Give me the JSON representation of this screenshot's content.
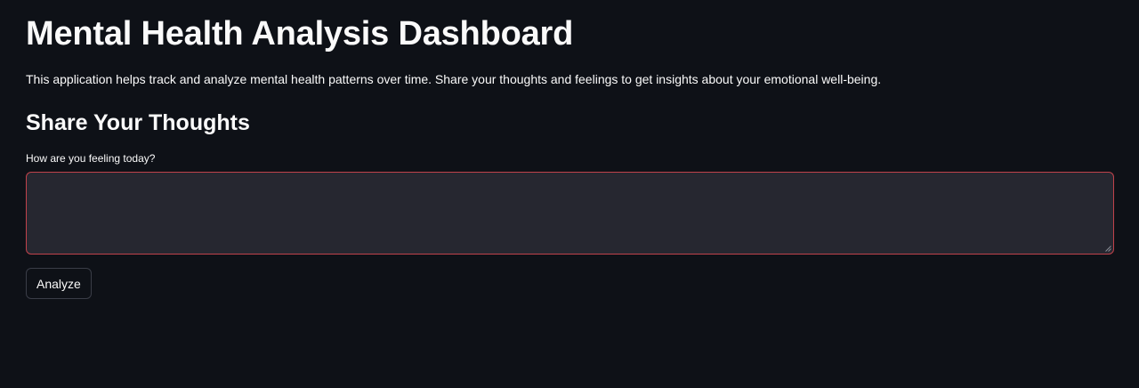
{
  "header": {
    "title": "Mental Health Analysis Dashboard"
  },
  "intro": {
    "text": "This application helps track and analyze mental health patterns over time. Share your thoughts and feelings to get insights about your emotional well-being."
  },
  "section": {
    "heading": "Share Your Thoughts",
    "input_label": "How are you feeling today?",
    "input_value": ""
  },
  "actions": {
    "analyze_label": "Analyze"
  },
  "colors": {
    "background": "#0e1117",
    "input_background": "#262730",
    "input_border": "#c0424b",
    "text": "#fafafa"
  }
}
